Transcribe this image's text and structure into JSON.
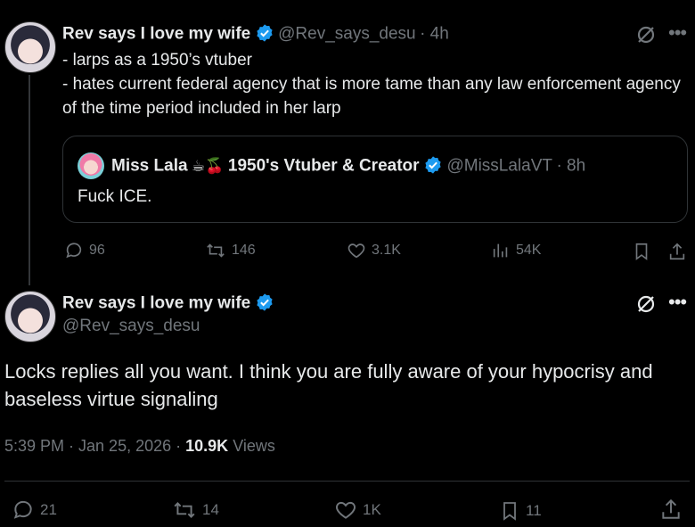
{
  "first_tweet": {
    "name": "Rev says I love my wife",
    "handle": "@Rev_says_desu",
    "time": "· 4h",
    "text": "- larps as a 1950’s vtuber\n- hates current federal agency that is more tame than any law enforcement agency of the time period included in her larp",
    "quote": {
      "name": "Miss Lala",
      "emoji": "☕🍒",
      "name_suffix": "1950's Vtuber & Creator",
      "handle": "@MissLalaVT",
      "time": "· 8h",
      "text": "Fuck ICE."
    },
    "actions": {
      "replies": "96",
      "reposts": "146",
      "likes": "3.1K",
      "views": "54K"
    }
  },
  "main_tweet": {
    "name": "Rev says I love my wife",
    "handle": "@Rev_says_desu",
    "text": "Locks replies all you want. I think you are fully aware of your hypocrisy and baseless virtue signaling",
    "timestamp": "5:39 PM · Jan 25, 2026 ·",
    "views_count": "10.9K",
    "views_label": "Views",
    "actions": {
      "replies": "21",
      "reposts": "14",
      "likes": "1K",
      "bookmarks": "11"
    }
  },
  "colors": {
    "background": "#000000",
    "text": "#e7e9ea",
    "muted": "#71767b",
    "verified": "#1d9bf0",
    "border": "#2f3336"
  }
}
